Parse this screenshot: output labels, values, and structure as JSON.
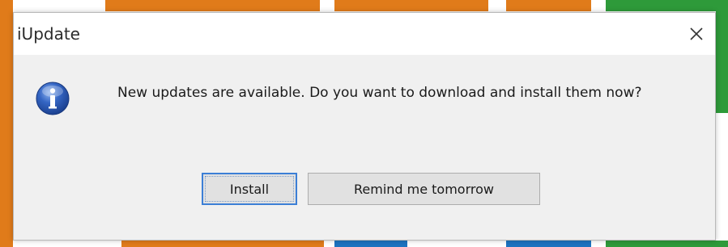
{
  "desktop": {
    "tile_colors": [
      "#e07b1a",
      "#1c73c0",
      "#2e9a3a",
      "#ffffff"
    ]
  },
  "dialog": {
    "title": "iUpdate",
    "close_icon": "close-icon",
    "icon": "info-icon",
    "message": "New updates are available. Do you want to download and install them now?",
    "buttons": {
      "install_label": "Install",
      "remind_label": "Remind me tomorrow"
    }
  }
}
